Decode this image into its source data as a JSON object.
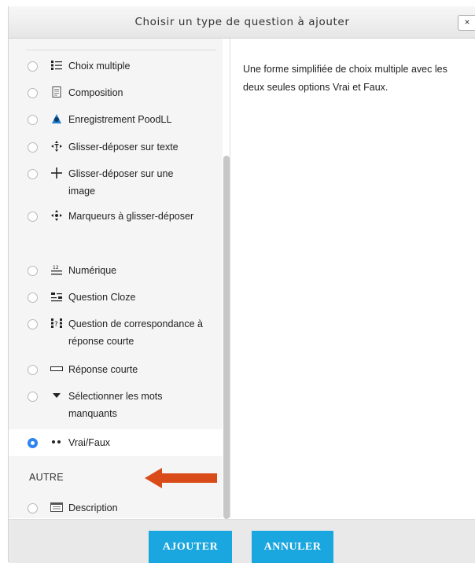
{
  "dialog": {
    "title": "Choisir un type de question à ajouter",
    "close_label": "×"
  },
  "options": [
    {
      "label": "Choix multiple",
      "icon": "multichoice-icon"
    },
    {
      "label": "Composition",
      "icon": "essay-icon"
    },
    {
      "label": "Enregistrement PoodLL",
      "icon": "poodll-icon"
    },
    {
      "label": "Glisser-déposer sur texte",
      "icon": "drag-drop-text-icon"
    },
    {
      "label": "Glisser-déposer sur une image",
      "icon": "drag-drop-image-icon"
    },
    {
      "label": "Marqueurs à glisser-déposer",
      "icon": "drag-drop-markers-icon"
    },
    {
      "label": "Numérique",
      "icon": "numerical-icon"
    },
    {
      "label": "Question Cloze",
      "icon": "cloze-icon"
    },
    {
      "label": "Question de correspondance à réponse courte",
      "icon": "random-short-answer-match-icon"
    },
    {
      "label": "Réponse courte",
      "icon": "short-answer-icon"
    },
    {
      "label": "Sélectionner les mots manquants",
      "icon": "select-missing-words-icon"
    },
    {
      "label": "Vrai/Faux",
      "icon": "true-false-icon",
      "selected": true
    },
    {
      "label": "Description",
      "icon": "description-icon"
    }
  ],
  "other_section": "AUTRE",
  "description": "Une forme simplifiée de choix multiple avec les deux seules options Vrai et Faux.",
  "footer": {
    "add_label": "AJOUTER",
    "cancel_label": "ANNULER"
  },
  "colors": {
    "accent": "#1aa6df",
    "radio_selected": "#2f84f1",
    "arrow": "#d94c1a"
  }
}
